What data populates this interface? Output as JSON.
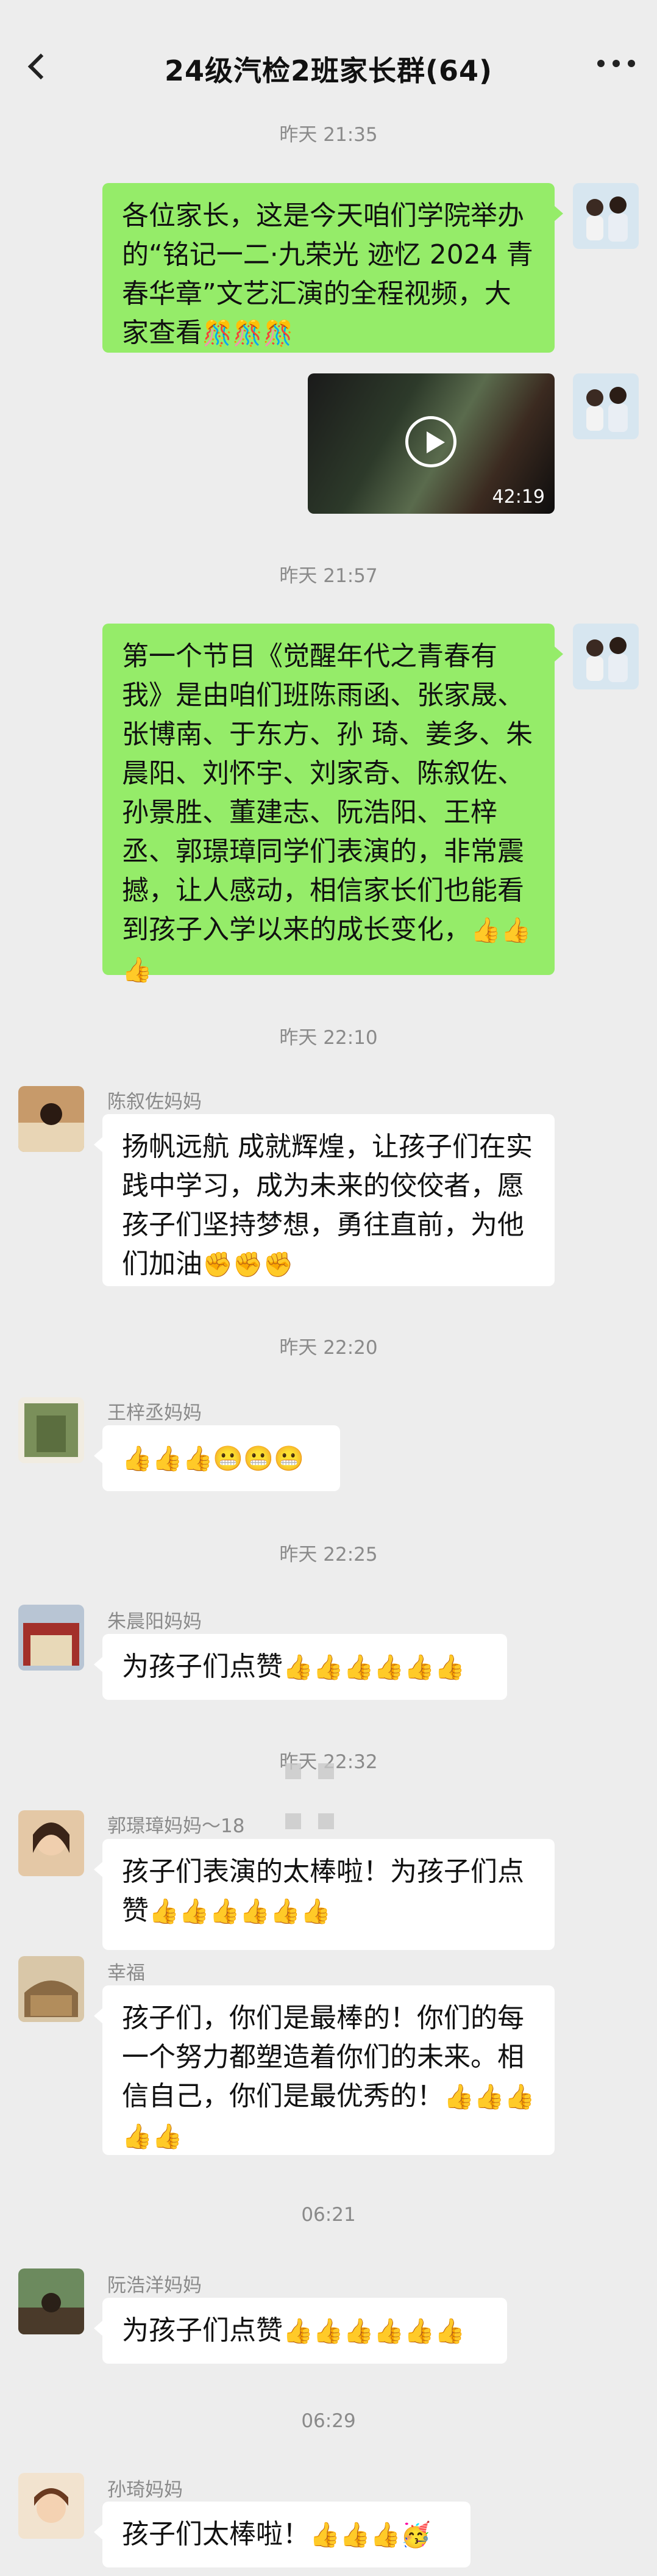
{
  "header": {
    "title": "24级汽检2班家长群(64)"
  },
  "timestamps": [
    "昨天 21:35",
    "昨天 21:57",
    "昨天 22:10",
    "昨天 22:20",
    "昨天 22:25",
    "昨天 22:32",
    "06:21",
    "06:29"
  ],
  "messages": {
    "m1": {
      "text": "各位家长，这是今天咱们学院举办的“铭记一二·九荣光 迹忆 2024 青春华章”文艺汇演的全程视频，大家查看",
      "emoji": "🎊🎊🎊"
    },
    "m2": {
      "duration": "42:19"
    },
    "m3": {
      "text": "第一个节目《觉醒年代之青春有我》是由咱们班陈雨函、张家晟、张博南、于东方、孙 琦、姜多、朱晨阳、刘怀宇、刘家奇、陈叙佐、孙景胜、董建志、阮浩阳、王梓丞、郭璟璋同学们表演的，非常震撼，让人感动，相信家长们也能看到孩子入学以来的成长变化，",
      "emoji": "👍👍👍"
    },
    "m4": {
      "sender": "陈叙佐妈妈",
      "text": "扬帆远航 成就辉煌，让孩子们在实践中学习，成为未来的佼佼者，愿孩子们坚持梦想，勇往直前，为他们加油",
      "emoji": "✊✊✊"
    },
    "m5": {
      "sender": "王梓丞妈妈",
      "emoji": "👍👍👍😬😬😬"
    },
    "m6": {
      "sender": "朱晨阳妈妈",
      "text": "为孩子们点赞",
      "emoji": "👍👍👍👍👍👍"
    },
    "m7": {
      "sender": "郭璟璋妈妈～18",
      "text": "孩子们表演的太棒啦！为孩子们点赞",
      "emoji": "👍👍👍👍👍👍"
    },
    "m8": {
      "sender": "幸福",
      "text": "孩子们，你们是最棒的！你们的每一个努力都塑造着你们的未来。相信自己，你们是最优秀的！",
      "emoji": "👍👍👍👍👍"
    },
    "m9": {
      "sender": "阮浩洋妈妈",
      "text": "为孩子们点赞",
      "emoji": "👍👍👍👍👍👍"
    },
    "m10": {
      "sender": "孙琦妈妈",
      "text": "孩子们太棒啦！",
      "emoji": "👍👍👍🥳"
    }
  },
  "colors": {
    "bg": "#ededed",
    "me_bubble": "#95ec69",
    "other_bubble": "#ffffff",
    "meta": "#8a8a8a"
  }
}
